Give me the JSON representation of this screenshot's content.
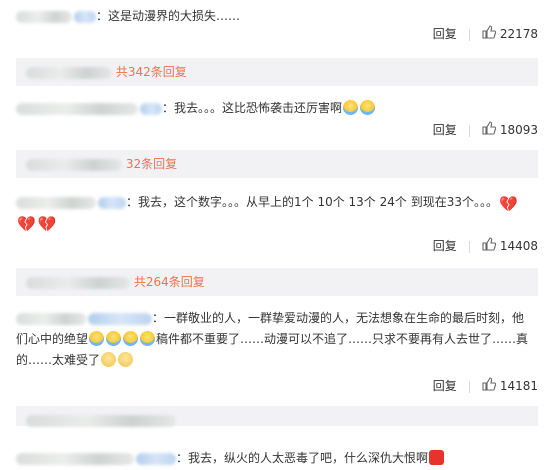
{
  "comments": [
    {
      "text": "：这是动漫界的大损失……",
      "reply_label": "回复",
      "likes": "22178",
      "sub_replies": "共342条回复"
    },
    {
      "text": "：我去。。。这比恐怖袭击还厉害啊",
      "reply_label": "回复",
      "likes": "18093",
      "sub_replies": "32条回复"
    },
    {
      "text": "：我去，这个数字。。。从早上的1个 10个 13个 24个 到现在33个。。。",
      "reply_label": "回复",
      "likes": "14408",
      "sub_replies": "共264条回复"
    },
    {
      "text_line1": "：一群敬业的人，一群挚爱动漫的人，无法想象在生命的最后时刻，他",
      "text_line2_a": "们心中的绝望",
      "text_line2_b": "稿件都不重要了……动漫可以不追了……只求不要再有人去世了……真",
      "text_line3": "的……太难受了",
      "reply_label": "回复",
      "likes": "14181"
    },
    {
      "text": "：我去，纵火的人太恶毒了吧，什么深仇大恨啊"
    }
  ],
  "icons": {
    "like": "thumbs-up-icon",
    "emoji_cry": "crying-face-icon",
    "emoji_heartbroken": "broken-heart-icon",
    "emoji_sad": "sad-face-icon"
  },
  "colors": {
    "link": "#eb7350",
    "subbar_bg": "#f2f2f5"
  }
}
